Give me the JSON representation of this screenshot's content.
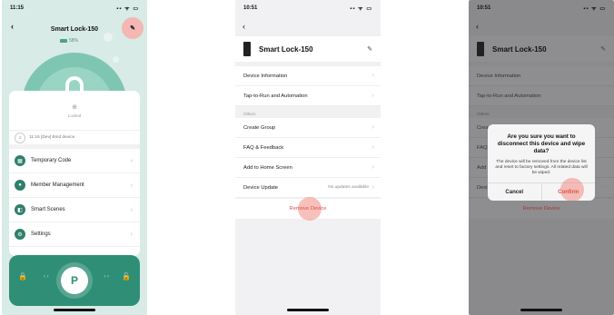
{
  "phone1": {
    "status_time": "11:15",
    "status_icons": "▪▪ ᯤ ▭",
    "back": "‹",
    "title": "Smart Lock-150",
    "edit_icon": "✎",
    "battery": "58%",
    "lock_state_icon": "⊕",
    "lock_state": "Locked",
    "log_text": "11:15  [Dev]  Bind device",
    "menu": [
      {
        "label": "Temporary Code",
        "icon": "▦"
      },
      {
        "label": "Member Management",
        "icon": "●"
      },
      {
        "label": "Smart Scenes",
        "icon": "◧"
      },
      {
        "label": "Settings",
        "icon": "⚙"
      }
    ],
    "chevron": "›",
    "unlock_left_icon": "🔒",
    "unlock_right_icon": "🔓",
    "key_label": "P",
    "arrows_left": "‹ ‹",
    "arrows_right": "› ›"
  },
  "phone2": {
    "status_time": "10:51",
    "status_icons": "▪▪ ᯤ ▭",
    "back": "‹",
    "device_name": "Smart Lock-150",
    "edit_icon": "✎",
    "chevron": "›",
    "items_top": [
      "Device Information",
      "Tap-to-Run and Automation"
    ],
    "section_label": "Others",
    "items_others": [
      "Create Group",
      "FAQ & Feedback",
      "Add to Home Screen"
    ],
    "device_update": {
      "label": "Device Update",
      "value": "No updates available"
    },
    "remove_label": "Remove Device"
  },
  "phone3": {
    "status_time": "10:51",
    "status_icons": "▪▪ ᯤ ▭",
    "back": "‹",
    "device_name": "Smart Lock-150",
    "edit_icon": "✎",
    "chevron": "›",
    "items_top": [
      "Device Information",
      "Tap-to-Run and Automation"
    ],
    "section_label": "Others",
    "items_others": [
      "Crea",
      "FAQ",
      "Add"
    ],
    "device_update": {
      "label": "Devi",
      "value": "ile"
    },
    "remove_label": "Remove Device",
    "dialog": {
      "title": "Are you sure you want to disconnect this device and wipe data?",
      "body": "The device will be removed from the device list and reset to factory settings. All related data will be wiped.",
      "cancel": "Cancel",
      "confirm": "Confirm"
    }
  }
}
